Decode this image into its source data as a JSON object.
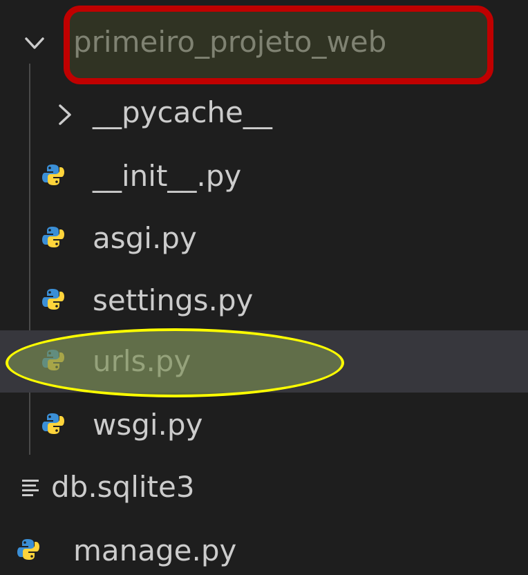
{
  "explorer": {
    "folder": {
      "name": "primeiro_projeto_web",
      "expanded": true,
      "chevron": "chevron-down-icon"
    },
    "subfolder": {
      "name": "__pycache__",
      "expanded": false,
      "chevron": "chevron-right-icon"
    },
    "files": [
      {
        "name": "__init__.py",
        "icon": "python-icon"
      },
      {
        "name": "asgi.py",
        "icon": "python-icon"
      },
      {
        "name": "settings.py",
        "icon": "python-icon"
      },
      {
        "name": "urls.py",
        "icon": "python-icon",
        "selected": true
      },
      {
        "name": "wsgi.py",
        "icon": "python-icon"
      }
    ],
    "root_files": [
      {
        "name": "db.sqlite3",
        "icon": "text-file-icon"
      },
      {
        "name": "manage.py",
        "icon": "python-icon"
      }
    ]
  },
  "annotations": {
    "rectangle_color": "#c00000",
    "ellipse_color": "#ffff00"
  },
  "colors": {
    "background": "#1e1e1e",
    "text": "#cccccc",
    "selected_row": "#37373d",
    "python_blue": "#3b8fd6",
    "python_yellow": "#ffd43b"
  }
}
